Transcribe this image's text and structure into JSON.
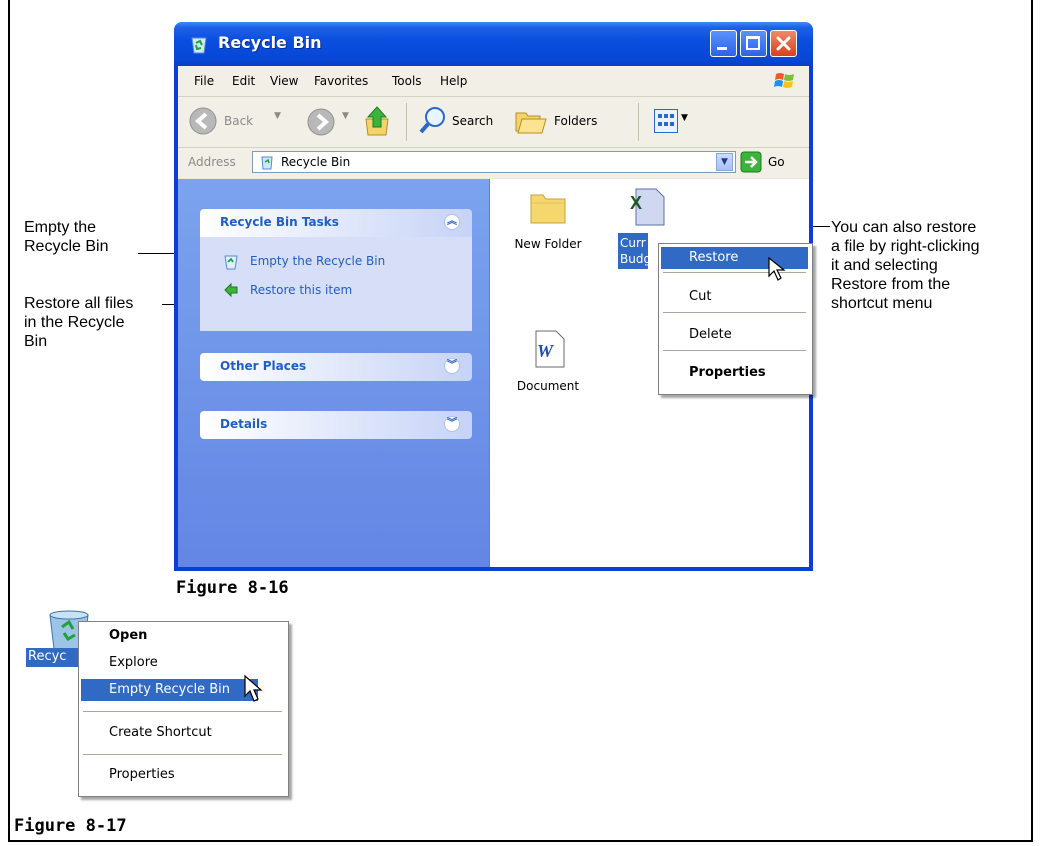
{
  "window": {
    "title": "Recycle Bin",
    "menu": [
      "File",
      "Edit",
      "View",
      "Favorites",
      "Tools",
      "Help"
    ],
    "toolbar": {
      "back": "Back",
      "search": "Search",
      "folders": "Folders"
    },
    "address": {
      "label": "Address",
      "value": "Recycle Bin",
      "go": "Go"
    },
    "panels": {
      "tasks": {
        "title": "Recycle Bin Tasks",
        "items": [
          "Empty the Recycle Bin",
          "Restore this item"
        ]
      },
      "other_places": "Other Places",
      "details": "Details"
    },
    "files": [
      {
        "name": "New Folder",
        "icon": "folder-icon"
      },
      {
        "name": "Curr Budg",
        "icon": "excel-file-icon"
      },
      {
        "name": "Document",
        "icon": "word-document-icon"
      }
    ],
    "file_menu": [
      "Restore",
      "Cut",
      "Delete",
      "Properties"
    ]
  },
  "callouts": {
    "empty": "Empty the\nRecycle Bin",
    "restore_all": "Restore all files\nin the Recycle\nBin",
    "restore_file": "You can also restore\na file by right-clicking\nit and selecting\nRestore from the\nshortcut menu"
  },
  "figure_16": "Figure 8-16",
  "figure_17": "Figure 8-17",
  "desktop": {
    "icon_label": "Recyc",
    "menu": [
      "Open",
      "Explore",
      "Empty Recycle Bin",
      "Create Shortcut",
      "Properties"
    ]
  },
  "colors": {
    "titlebar": "#0a4fe0",
    "task_pane": "#6f95e8",
    "selection": "#316ac5",
    "link": "#215dc6"
  }
}
